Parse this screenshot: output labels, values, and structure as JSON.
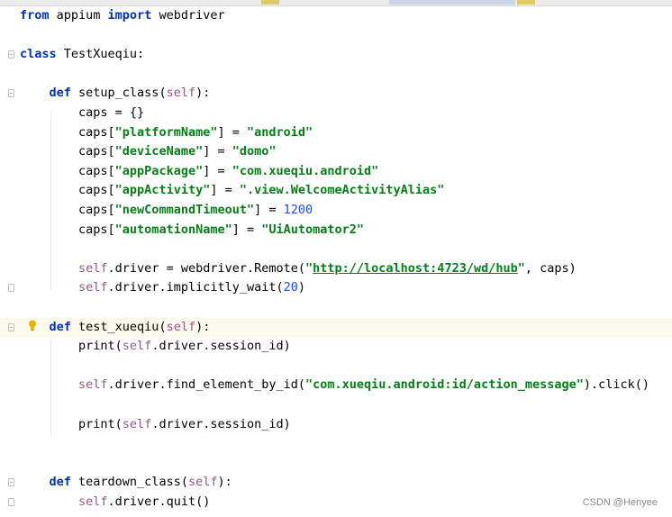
{
  "editor": {
    "lines": [
      {
        "id": "l1",
        "parts": [
          {
            "t": "from",
            "c": "kw"
          },
          {
            "t": " appium ",
            "c": "fn"
          },
          {
            "t": "import",
            "c": "kw"
          },
          {
            "t": " webdriver",
            "c": "fn"
          }
        ]
      },
      {
        "id": "l2",
        "parts": []
      },
      {
        "id": "l3",
        "parts": [
          {
            "t": "class",
            "c": "kw"
          },
          {
            "t": " TestXueqiu:",
            "c": "fn"
          }
        ]
      },
      {
        "id": "l4",
        "parts": []
      },
      {
        "id": "l5",
        "parts": [
          {
            "t": "    "
          },
          {
            "t": "def",
            "c": "kw"
          },
          {
            "t": " setup_class(",
            "c": "fn"
          },
          {
            "t": "self",
            "c": "self"
          },
          {
            "t": "):",
            "c": "fn"
          }
        ]
      },
      {
        "id": "l6",
        "parts": [
          {
            "t": "        caps = {}",
            "c": "fn"
          }
        ]
      },
      {
        "id": "l7",
        "parts": [
          {
            "t": "        caps[",
            "c": "fn"
          },
          {
            "t": "\"platformName\"",
            "c": "str"
          },
          {
            "t": "] = ",
            "c": "fn"
          },
          {
            "t": "\"android\"",
            "c": "str"
          }
        ]
      },
      {
        "id": "l8",
        "parts": [
          {
            "t": "        caps[",
            "c": "fn"
          },
          {
            "t": "\"deviceName\"",
            "c": "str"
          },
          {
            "t": "] = ",
            "c": "fn"
          },
          {
            "t": "\"domo\"",
            "c": "str"
          }
        ]
      },
      {
        "id": "l9",
        "parts": [
          {
            "t": "        caps[",
            "c": "fn"
          },
          {
            "t": "\"appPackage\"",
            "c": "str"
          },
          {
            "t": "] = ",
            "c": "fn"
          },
          {
            "t": "\"com.xueqiu.android\"",
            "c": "str"
          }
        ]
      },
      {
        "id": "l10",
        "parts": [
          {
            "t": "        caps[",
            "c": "fn"
          },
          {
            "t": "\"appActivity\"",
            "c": "str"
          },
          {
            "t": "] = ",
            "c": "fn"
          },
          {
            "t": "\".view.WelcomeActivityAlias\"",
            "c": "str"
          }
        ]
      },
      {
        "id": "l11",
        "parts": [
          {
            "t": "        caps[",
            "c": "fn"
          },
          {
            "t": "\"newCommandTimeout\"",
            "c": "str"
          },
          {
            "t": "] = ",
            "c": "fn"
          },
          {
            "t": "1200",
            "c": "num"
          }
        ]
      },
      {
        "id": "l12",
        "parts": [
          {
            "t": "        caps[",
            "c": "fn"
          },
          {
            "t": "\"automationName\"",
            "c": "str"
          },
          {
            "t": "] = ",
            "c": "fn"
          },
          {
            "t": "\"UiAutomator2\"",
            "c": "str"
          }
        ]
      },
      {
        "id": "l13",
        "parts": []
      },
      {
        "id": "l14",
        "parts": [
          {
            "t": "        "
          },
          {
            "t": "self",
            "c": "self"
          },
          {
            "t": ".driver = webdriver.Remote(",
            "c": "fn"
          },
          {
            "t": "\"",
            "c": "str"
          },
          {
            "t": "http://localhost:4723/wd/hub",
            "c": "link"
          },
          {
            "t": "\"",
            "c": "str"
          },
          {
            "t": ", caps)",
            "c": "fn"
          }
        ]
      },
      {
        "id": "l15",
        "parts": [
          {
            "t": "        "
          },
          {
            "t": "self",
            "c": "self"
          },
          {
            "t": ".driver.implicitly_wait(",
            "c": "fn"
          },
          {
            "t": "20",
            "c": "num"
          },
          {
            "t": ")",
            "c": "fn"
          }
        ]
      },
      {
        "id": "l16",
        "parts": []
      },
      {
        "id": "l17",
        "parts": [
          {
            "t": "    "
          },
          {
            "t": "def",
            "c": "kw"
          },
          {
            "t": " test_xueqiu(",
            "c": "fn"
          },
          {
            "t": "self",
            "c": "self"
          },
          {
            "t": "):",
            "c": "fn"
          }
        ]
      },
      {
        "id": "l18",
        "parts": [
          {
            "t": "        print(",
            "c": "fn"
          },
          {
            "t": "self",
            "c": "self"
          },
          {
            "t": ".driver.session_id)",
            "c": "fn"
          }
        ]
      },
      {
        "id": "l19",
        "parts": []
      },
      {
        "id": "l20",
        "parts": [
          {
            "t": "        "
          },
          {
            "t": "self",
            "c": "self"
          },
          {
            "t": ".driver.find_element_by_id(",
            "c": "fn"
          },
          {
            "t": "\"com.xueqiu.android:id/action_message\"",
            "c": "str"
          },
          {
            "t": ").click()",
            "c": "fn"
          }
        ]
      },
      {
        "id": "l21",
        "parts": []
      },
      {
        "id": "l22",
        "parts": [
          {
            "t": "        print(",
            "c": "fn"
          },
          {
            "t": "self",
            "c": "self"
          },
          {
            "t": ".driver.session_id)",
            "c": "fn"
          }
        ]
      },
      {
        "id": "l23",
        "parts": []
      },
      {
        "id": "l24",
        "parts": []
      },
      {
        "id": "l25",
        "parts": [
          {
            "t": "    "
          },
          {
            "t": "def",
            "c": "kw"
          },
          {
            "t": " teardown_class(",
            "c": "fn"
          },
          {
            "t": "self",
            "c": "self"
          },
          {
            "t": "):",
            "c": "fn"
          }
        ]
      },
      {
        "id": "l26",
        "parts": [
          {
            "t": "        "
          },
          {
            "t": "self",
            "c": "self"
          },
          {
            "t": ".driver.quit()",
            "c": "fn"
          }
        ]
      }
    ],
    "current_line": "l17",
    "intention_icon": "lightbulb-icon"
  },
  "watermark": "CSDN @Henyee",
  "colors": {
    "keyword": "#0033b3",
    "self": "#94558d",
    "string": "#067d17",
    "number": "#1750eb",
    "current_line_bg": "#fcfaed",
    "bulb": "#f0b400"
  }
}
